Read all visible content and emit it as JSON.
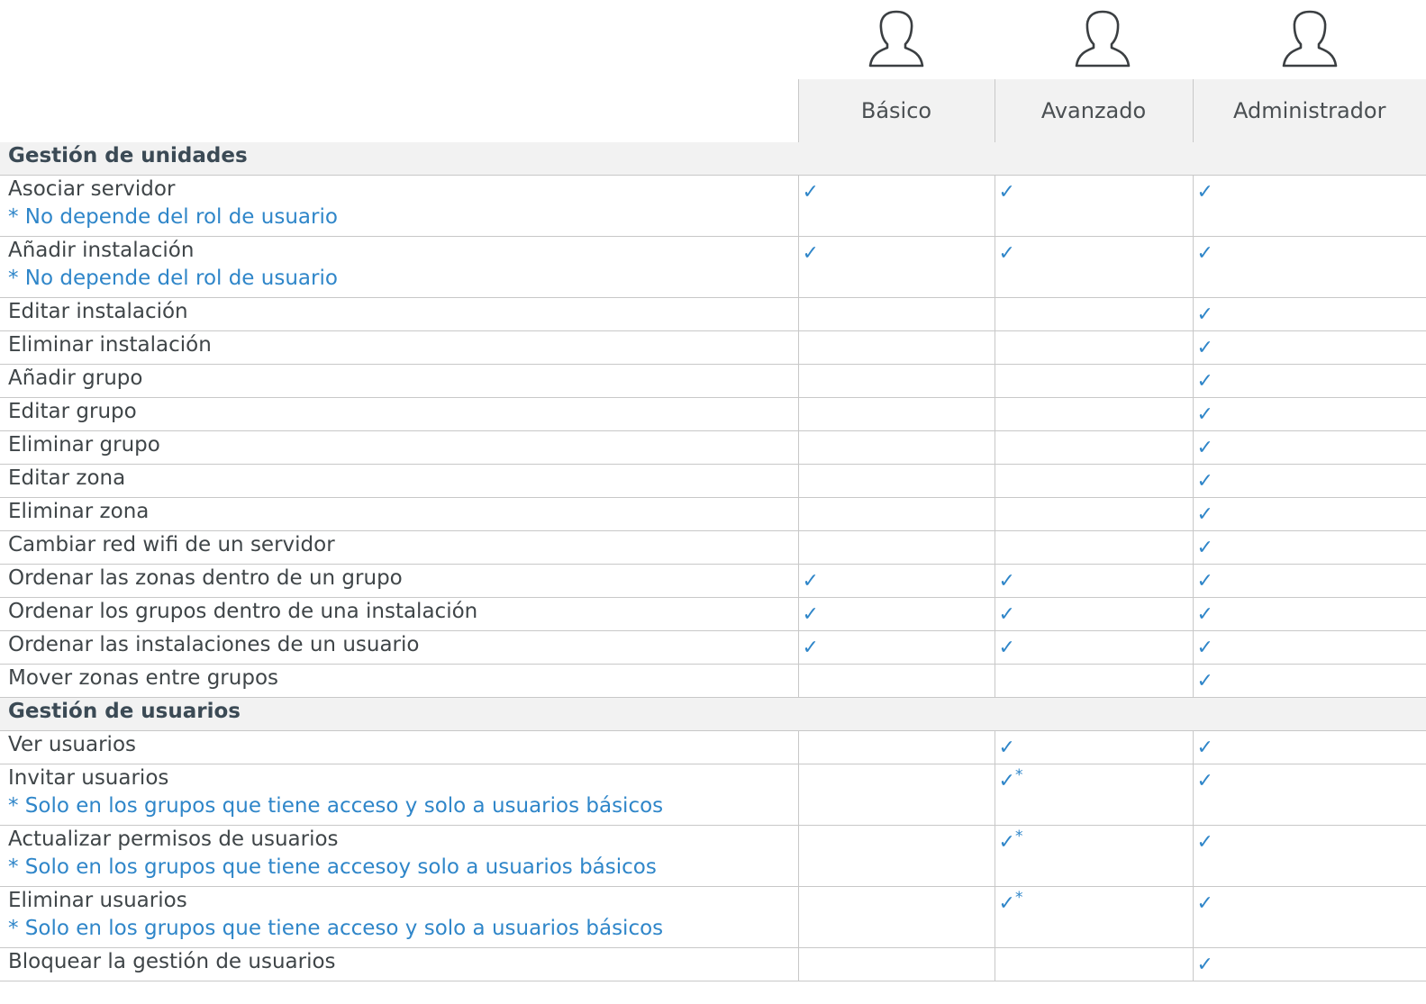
{
  "icons": [
    "user-icon",
    "user-icon",
    "user-icon"
  ],
  "colors": {
    "accent": "#2f86c9",
    "header_bg": "#f2f2f2",
    "text": "#3f4548"
  },
  "columns": [
    "Básico",
    "Avanzado",
    "Administrador"
  ],
  "sections": [
    {
      "title": "Gestión de unidades",
      "rows": [
        {
          "label": "Asociar servidor",
          "note": "* No depende del rol de usuario",
          "basico": "✓",
          "avanzado": "✓",
          "admin": "✓"
        },
        {
          "label": "Añadir instalación",
          "note": "* No depende del rol de usuario",
          "basico": "✓",
          "avanzado": "✓",
          "admin": "✓"
        },
        {
          "label": "Editar instalación",
          "basico": "",
          "avanzado": "",
          "admin": "✓"
        },
        {
          "label": "Eliminar instalación",
          "basico": "",
          "avanzado": "",
          "admin": "✓"
        },
        {
          "label": "Añadir grupo",
          "basico": "",
          "avanzado": "",
          "admin": "✓"
        },
        {
          "label": "Editar grupo",
          "basico": "",
          "avanzado": "",
          "admin": "✓"
        },
        {
          "label": "Eliminar grupo",
          "basico": "",
          "avanzado": "",
          "admin": "✓"
        },
        {
          "label": "Editar zona",
          "basico": "",
          "avanzado": "",
          "admin": "✓"
        },
        {
          "label": "Eliminar zona",
          "basico": "",
          "avanzado": "",
          "admin": "✓"
        },
        {
          "label": "Cambiar red wifi de un servidor",
          "basico": "",
          "avanzado": "",
          "admin": "✓"
        },
        {
          "label": "Ordenar las zonas dentro de un grupo",
          "basico": "✓",
          "avanzado": "✓",
          "admin": "✓"
        },
        {
          "label": "Ordenar los grupos dentro de una instalación",
          "basico": "✓",
          "avanzado": "✓",
          "admin": "✓"
        },
        {
          "label": "Ordenar las instalaciones de un usuario",
          "basico": "✓",
          "avanzado": "✓",
          "admin": "✓"
        },
        {
          "label": "Mover zonas entre grupos",
          "basico": "",
          "avanzado": "",
          "admin": "✓"
        }
      ]
    },
    {
      "title": "Gestión de usuarios",
      "rows": [
        {
          "label": "Ver usuarios",
          "basico": "",
          "avanzado": "✓",
          "admin": "✓"
        },
        {
          "label": "Invitar usuarios",
          "note": "* Solo en los grupos que tiene acceso y solo a usuarios básicos",
          "basico": "",
          "avanzado": "✓",
          "avanzado_star": "*",
          "admin": "✓"
        },
        {
          "label": "Actualizar permisos de usuarios",
          "note": "* Solo en los grupos que tiene accesoy solo a usuarios básicos",
          "basico": "",
          "avanzado": "✓",
          "avanzado_star": "*",
          "admin": "✓"
        },
        {
          "label": "Eliminar usuarios",
          "note": "* Solo en los grupos que tiene acceso y solo a usuarios básicos",
          "basico": "",
          "avanzado": "✓",
          "avanzado_star": "*",
          "admin": "✓"
        },
        {
          "label": "Bloquear la gestión de usuarios",
          "basico": "",
          "avanzado": "",
          "admin": "✓"
        }
      ]
    }
  ]
}
